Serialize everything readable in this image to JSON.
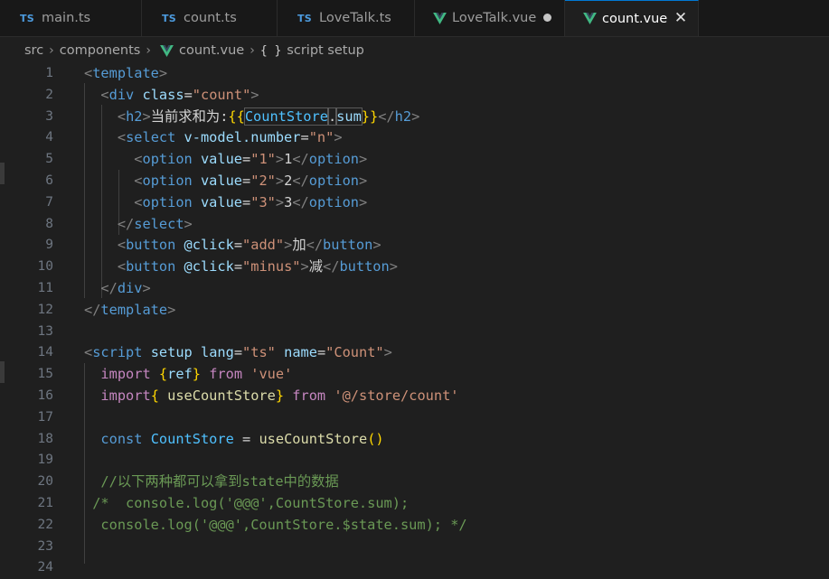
{
  "tabs": [
    {
      "icon": "TS",
      "label": "main.ts"
    },
    {
      "icon": "TS",
      "label": "count.ts"
    },
    {
      "icon": "TS",
      "label": "LoveTalk.ts"
    },
    {
      "icon": "vue-icon",
      "label": "LoveTalk.vue",
      "modified": true
    },
    {
      "icon": "vue-icon",
      "label": "count.vue",
      "active": true
    }
  ],
  "breadcrumb": {
    "items": [
      "src",
      "components",
      "count.vue",
      "script setup"
    ],
    "braces": "{ }"
  },
  "colors": {
    "accent": "#0078d4",
    "vue_green": "#41b883",
    "ts_blue": "#4d9ce0"
  },
  "lines": [
    {
      "n": "1",
      "t": [
        "<",
        "template",
        ">"
      ]
    },
    {
      "n": "2",
      "t": [
        "  ",
        "<",
        "div",
        " ",
        "class",
        "=",
        "\"",
        "count",
        "\"",
        ">"
      ]
    },
    {
      "n": "3",
      "t": [
        "    ",
        "<",
        "h2",
        ">",
        "当前求和为:",
        "{{",
        "CountStore",
        ".",
        "sum",
        "}}",
        "</",
        "h2",
        ">"
      ]
    },
    {
      "n": "4",
      "t": [
        "    ",
        "<",
        "select",
        " ",
        "v-model.number",
        "=",
        "\"n\"",
        ">"
      ]
    },
    {
      "n": "5",
      "t": [
        "      ",
        "<",
        "option",
        " ",
        "value",
        "=",
        "\"1\"",
        ">",
        "1",
        "</",
        "option",
        ">"
      ]
    },
    {
      "n": "6",
      "t": [
        "      ",
        "<",
        "option",
        " ",
        "value",
        "=",
        "\"2\"",
        ">",
        "2",
        "</",
        "option",
        ">"
      ]
    },
    {
      "n": "7",
      "t": [
        "      ",
        "<",
        "option",
        " ",
        "value",
        "=",
        "\"3\"",
        ">",
        "3",
        "</",
        "option",
        ">"
      ]
    },
    {
      "n": "8",
      "t": [
        "    ",
        "</",
        "select",
        ">"
      ]
    },
    {
      "n": "9",
      "t": [
        "    ",
        "<",
        "button",
        " ",
        "@click",
        "=",
        "\"add\"",
        ">",
        "加",
        "</",
        "button",
        ">"
      ]
    },
    {
      "n": "10",
      "t": [
        "    ",
        "<",
        "button",
        " ",
        "@click",
        "=",
        "\"minus\"",
        ">",
        "减",
        "</",
        "button",
        ">"
      ]
    },
    {
      "n": "11",
      "t": [
        "  ",
        "</",
        "div",
        ">"
      ]
    },
    {
      "n": "12",
      "t": [
        "</",
        "template",
        ">"
      ]
    },
    {
      "n": "13",
      "t": []
    },
    {
      "n": "14",
      "t": [
        "<",
        "script",
        " ",
        "setup",
        " ",
        "lang",
        "=",
        "\"ts\"",
        " ",
        "name",
        "=",
        "\"Count\"",
        ">"
      ]
    },
    {
      "n": "15",
      "t": [
        "  ",
        "import",
        " ",
        "{",
        "ref",
        "}",
        " ",
        "from",
        " ",
        "'vue'"
      ]
    },
    {
      "n": "16",
      "t": [
        "  ",
        "import",
        "{",
        " ",
        "useCountStore",
        "}",
        " ",
        "from",
        " ",
        "'@/store/count'"
      ]
    },
    {
      "n": "17",
      "t": []
    },
    {
      "n": "18",
      "t": [
        "  ",
        "const",
        " ",
        "CountStore",
        " ",
        "=",
        " ",
        "useCountStore",
        "(",
        ")"
      ]
    },
    {
      "n": "19",
      "t": []
    },
    {
      "n": "20",
      "t": [
        "  ",
        "//以下两种都可以拿到state中的数据"
      ]
    },
    {
      "n": "21",
      "t": [
        " ",
        "/*  console.log('@@@',CountStore.sum);"
      ]
    },
    {
      "n": "22",
      "t": [
        "  ",
        "console.log('@@@',CountStore.$state.sum); */"
      ]
    },
    {
      "n": "23",
      "t": []
    },
    {
      "n": "24",
      "t": []
    }
  ]
}
